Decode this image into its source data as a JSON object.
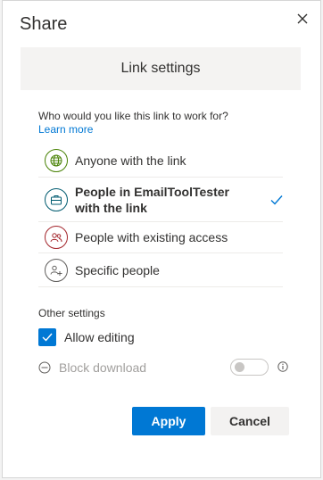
{
  "panel": {
    "title": "Share",
    "close_icon": "close-icon"
  },
  "settings": {
    "header": "Link settings",
    "question": "Who would you like this link to work for?",
    "learn_more": "Learn more"
  },
  "options": [
    {
      "label": "Anyone with the link",
      "icon": "globe-icon",
      "color": "#498205",
      "selected": false
    },
    {
      "label": "People in EmailToolTester with the link",
      "icon": "briefcase-icon",
      "color": "#005b70",
      "selected": true
    },
    {
      "label": "People with existing access",
      "icon": "people-icon",
      "color": "#a4262c",
      "selected": false
    },
    {
      "label": "Specific people",
      "icon": "people-add-icon",
      "color": "#605e5c",
      "selected": false
    }
  ],
  "other_settings": {
    "title": "Other settings",
    "allow_editing": {
      "label": "Allow editing",
      "checked": true
    },
    "block_download": {
      "label": "Block download",
      "enabled": false,
      "toggle_on": false
    }
  },
  "buttons": {
    "apply": "Apply",
    "cancel": "Cancel"
  },
  "colors": {
    "accent": "#0078d4",
    "check": "#0078d4"
  }
}
